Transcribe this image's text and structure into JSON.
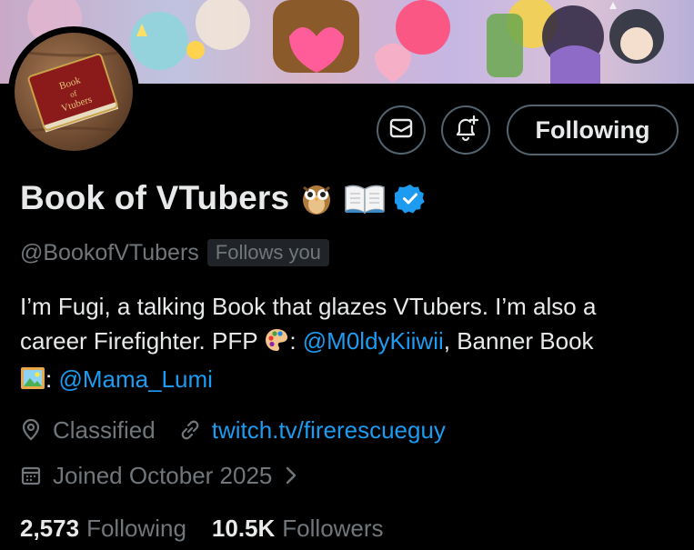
{
  "profile": {
    "display_name": "Book of VTubers",
    "name_emojis": [
      "owl-emoji",
      "open-book-emoji"
    ],
    "handle": "@BookofVTubers",
    "follows_you_label": "Follows you",
    "avatar_text": "Book of Vtubers",
    "verified_color": "#1d9bf0"
  },
  "actions": {
    "message_icon": "mail-icon",
    "notify_icon": "bell-plus-icon",
    "following_label": "Following"
  },
  "bio": {
    "line1": "I’m Fugi, a talking Book that glazes VTubers. I’m also a",
    "line2_text": "career Firefighter. PFP",
    "line2_colon": ":",
    "mention1": "@M0ldyKiiwii",
    "line2_after": ", Banner Book",
    "line3_colon": ":",
    "mention2": "@Mama_Lumi",
    "emoji_palette": "palette-emoji",
    "emoji_picture": "framed-picture-emoji"
  },
  "meta": {
    "location": "Classified",
    "website": "twitch.tv/firerescueguy",
    "joined": "Joined October 2025",
    "location_icon": "location-pin-icon",
    "link_icon": "link-icon",
    "calendar_icon": "calendar-icon",
    "chevron_icon": "chevron-right-icon"
  },
  "stats": {
    "following_count": "2,573",
    "following_label": "Following",
    "followers_count": "10.5K",
    "followers_label": "Followers"
  },
  "colors": {
    "background": "#000000",
    "text": "#e7e9ea",
    "muted": "#71767b",
    "accent": "#1d9bf0",
    "border": "#536471"
  }
}
